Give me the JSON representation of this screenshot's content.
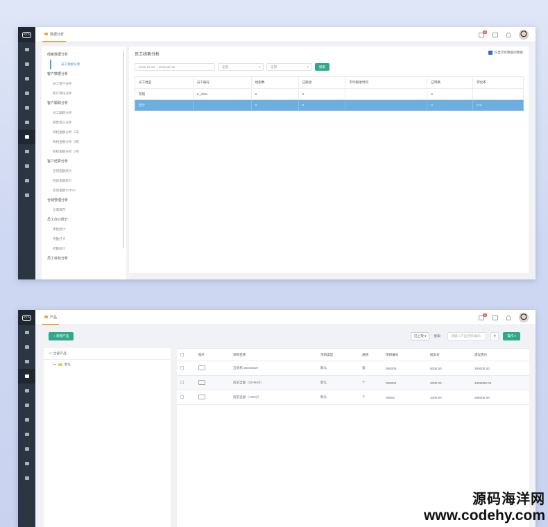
{
  "panel1": {
    "tab_label": "数据分析",
    "badge_count": "9",
    "menu": [
      {
        "type": "group",
        "label": "线索数据分析"
      },
      {
        "type": "item",
        "label": "员工线索分析",
        "active": true
      },
      {
        "type": "group",
        "label": "客户数据分析"
      },
      {
        "type": "item",
        "label": "员工客户分析"
      },
      {
        "type": "item",
        "label": "客户转化分析"
      },
      {
        "type": "group",
        "label": "客户跟踪分析"
      },
      {
        "type": "item",
        "label": "员工跟踪分析"
      },
      {
        "type": "item",
        "label": "销售漏斗分析"
      },
      {
        "type": "item",
        "label": "商机金额分析（日）"
      },
      {
        "type": "item",
        "label": "商机金额分析（周）"
      },
      {
        "type": "item",
        "label": "商机金额分析（月）"
      },
      {
        "type": "group",
        "label": "客户结算分析"
      },
      {
        "type": "item",
        "label": "合同金额统计"
      },
      {
        "type": "item",
        "label": "回款金额统计"
      },
      {
        "type": "item",
        "label": "合同金额TOP10"
      },
      {
        "type": "group",
        "label": "仓储管理分析"
      },
      {
        "type": "item",
        "label": "仓库库存"
      },
      {
        "type": "group",
        "label": "员工办公统计"
      },
      {
        "type": "item",
        "label": "审批统计"
      },
      {
        "type": "item",
        "label": "考勤打卡"
      },
      {
        "type": "item",
        "label": "考勤统计"
      },
      {
        "type": "group",
        "label": "员工目标分析"
      }
    ],
    "title": "员工线索分析",
    "checkbox_label": "仅显示有数据的数据",
    "date_range": "2022-02-02 ~ 2022-02-12",
    "select1": "全部",
    "select2": "全部",
    "search_btn": "搜索",
    "table": {
      "headers": [
        "员工姓名",
        "员工编号",
        "线索数",
        "已跟进",
        "平均跟进时间",
        "已转换",
        "转化率"
      ],
      "rows": [
        [
          "管理",
          "K_0001",
          "0",
          "0",
          "",
          "0",
          ""
        ],
        [
          "合计",
          "",
          "0",
          "0",
          "",
          "0",
          "0 %"
        ]
      ]
    }
  },
  "panel2": {
    "tab_label": "产品",
    "badge_count": "9",
    "add_btn": "+ 新增产品",
    "status_select": "已上架",
    "search_label": "搜索：",
    "search_placeholder": "请输入产品名称/编码",
    "op_btn": "操作 ▾",
    "tree_header": "全部产品",
    "tree_node": "默认",
    "table": {
      "headers": [
        "",
        "图片",
        "项目名称",
        "项目类型",
        "规格",
        "项目编号",
        "成本价",
        "建议售价"
      ],
      "rows": [
        [
          "",
          "",
          "五星机-20210019",
          "默认",
          "套",
          "000005",
          "5000.00",
          "350000.00"
        ],
        [
          "",
          "",
          "房前全屋（20-60㎡）",
          "默认",
          "个",
          "000002",
          "2000.00",
          "3396000.00"
        ],
        [
          "",
          "",
          "房前全屋（<30㎡）",
          "默认",
          "个",
          "00003",
          "1000.00",
          "298000.00"
        ]
      ]
    }
  },
  "watermark": {
    "line1": "源码海洋网",
    "line2": "www.codehy.com"
  }
}
